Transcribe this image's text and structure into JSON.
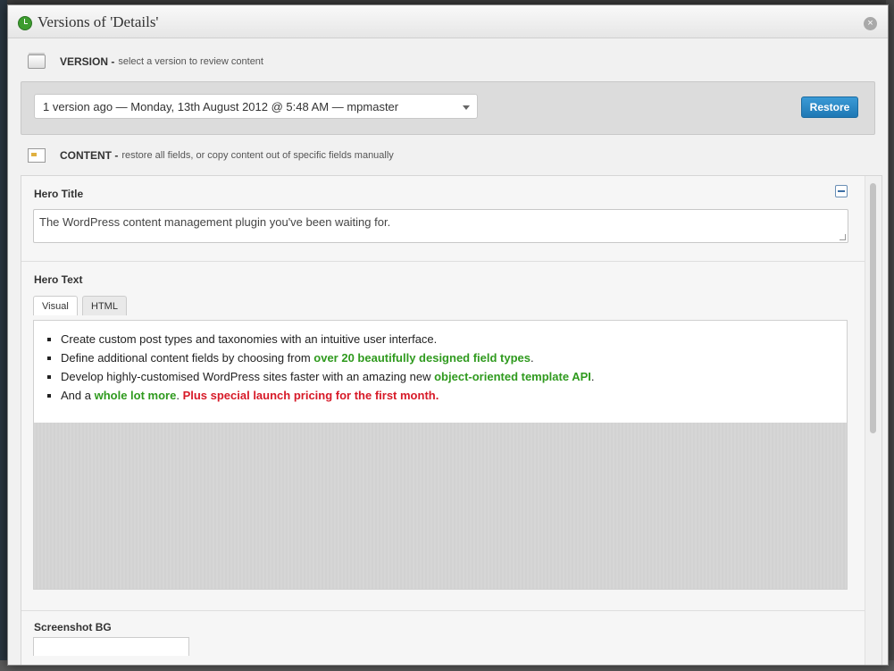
{
  "modal": {
    "title": "Versions of 'Details'",
    "close_symbol": "×"
  },
  "version_section": {
    "label": "VERSION -",
    "description": "select a version to review content",
    "icon": "version-stack-icon",
    "selected_version": "1 version ago — Monday, 13th August 2012 @ 5:48 AM — mpmaster",
    "restore_label": "Restore"
  },
  "content_section": {
    "label": "CONTENT -",
    "description": "restore all fields, or copy content out of specific fields manually",
    "icon": "content-fields-icon"
  },
  "fields": {
    "hero_title": {
      "label": "Hero Title",
      "value": "The WordPress content management plugin you've been waiting for."
    },
    "hero_text": {
      "label": "Hero Text",
      "tabs": [
        "Visual",
        "HTML"
      ],
      "active_tab": "Visual",
      "bullets": [
        {
          "parts": [
            {
              "text": "Create custom post types and taxonomies with an intuitive user interface.",
              "style": "plain"
            }
          ]
        },
        {
          "parts": [
            {
              "text": "Define additional content fields by choosing from ",
              "style": "plain"
            },
            {
              "text": "over 20 beautifully designed field types",
              "style": "green"
            },
            {
              "text": ".",
              "style": "plain"
            }
          ]
        },
        {
          "parts": [
            {
              "text": "Develop highly-customised WordPress sites faster with an amazing new ",
              "style": "plain"
            },
            {
              "text": "object-oriented template API",
              "style": "green"
            },
            {
              "text": ".",
              "style": "plain"
            }
          ]
        },
        {
          "parts": [
            {
              "text": "And a ",
              "style": "plain"
            },
            {
              "text": "whole lot more",
              "style": "green"
            },
            {
              "text": ". ",
              "style": "plain"
            },
            {
              "text": "Plus special launch pricing for the first month.",
              "style": "red"
            }
          ]
        }
      ]
    },
    "screenshot_bg": {
      "label": "Screenshot BG"
    }
  },
  "colors": {
    "accent_button": "#2180c0",
    "green_text": "#2f9a1e",
    "red_text": "#d71a28"
  }
}
